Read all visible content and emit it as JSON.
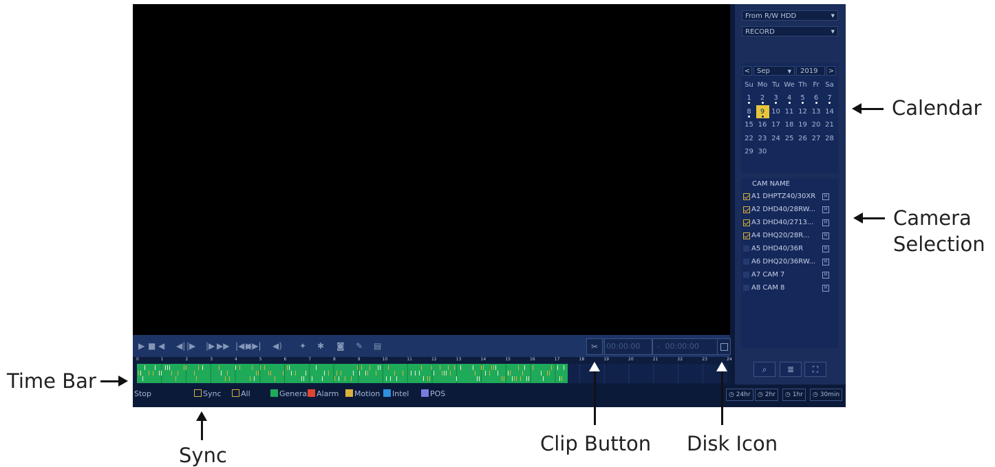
{
  "source": {
    "selected": "From R/W HDD"
  },
  "record_type": {
    "selected": "RECORD"
  },
  "calendar": {
    "month": "Sep",
    "year": "2019",
    "prev": "<",
    "next": ">",
    "weekdays": [
      "Su",
      "Mo",
      "Tu",
      "We",
      "Th",
      "Fr",
      "Sa"
    ],
    "weeks": [
      [
        "1",
        "2",
        "3",
        "4",
        "5",
        "6",
        "7"
      ],
      [
        "8",
        "9",
        "10",
        "11",
        "12",
        "13",
        "14"
      ],
      [
        "15",
        "16",
        "17",
        "18",
        "19",
        "20",
        "21"
      ],
      [
        "22",
        "23",
        "24",
        "25",
        "26",
        "27",
        "28"
      ],
      [
        "29",
        "30",
        "",
        "",
        "",
        "",
        ""
      ]
    ],
    "selected_day": "9",
    "days_with_recordings": [
      "1",
      "2",
      "3",
      "4",
      "5",
      "6",
      "7",
      "8",
      "9"
    ]
  },
  "cameras": {
    "header": "CAM NAME",
    "items": [
      {
        "name": "A1 DHPTZ40/30XR",
        "checked": true,
        "badge": "M"
      },
      {
        "name": "A2 DHD40/28RW...",
        "checked": true,
        "badge": "M"
      },
      {
        "name": "A3 DHD40/2713...",
        "checked": true,
        "badge": "M"
      },
      {
        "name": "A4 DHQ20/28R...",
        "checked": true,
        "badge": "M"
      },
      {
        "name": "A5 DHD40/36R",
        "checked": false,
        "badge": "M"
      },
      {
        "name": "A6 DHQ20/36RW...",
        "checked": false,
        "badge": "M"
      },
      {
        "name": "A7 CAM 7",
        "checked": false,
        "badge": "M"
      },
      {
        "name": "A8 CAM 8",
        "checked": false,
        "badge": "M"
      }
    ]
  },
  "clip": {
    "start": "00:00:00",
    "separator": "-",
    "end": "00:00:00"
  },
  "timebar": {
    "hour_labels": [
      "0",
      "1",
      "2",
      "3",
      "4",
      "5",
      "6",
      "7",
      "8",
      "9",
      "10",
      "11",
      "12",
      "13",
      "14",
      "15",
      "16",
      "17",
      "18",
      "19",
      "20",
      "21",
      "22",
      "23",
      "24"
    ],
    "recorded_until_hour": 17.5
  },
  "status": {
    "state": "Stop",
    "sync": "Sync",
    "all": "All",
    "legend": [
      {
        "label": "General",
        "color": "#1faa5a"
      },
      {
        "label": "Alarm",
        "color": "#e0452f"
      },
      {
        "label": "Motion",
        "color": "#d9b23b"
      },
      {
        "label": "Intel",
        "color": "#2f8fe0"
      },
      {
        "label": "POS",
        "color": "#7a7ae0"
      }
    ],
    "zoom": [
      "24hr",
      "2hr",
      "1hr",
      "30min"
    ]
  },
  "annotations": {
    "calendar": "Calendar",
    "camera_line1": "Camera",
    "camera_line2": "Selection",
    "time_bar": "Time Bar",
    "sync": "Sync",
    "clip_button": "Clip Button",
    "disk_icon": "Disk Icon"
  }
}
